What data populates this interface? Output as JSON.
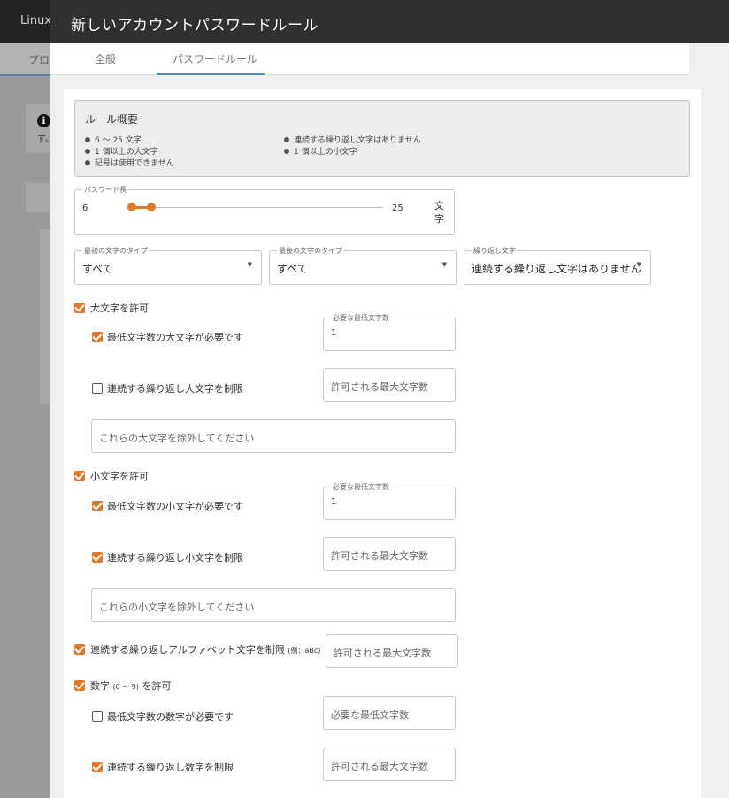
{
  "background": {
    "app_title": "Linux",
    "tab_partial": "プロ",
    "info_text": "す。"
  },
  "dialog": {
    "title": "新しいアカウントパスワードルール",
    "tabs": [
      {
        "label": "全般",
        "active": false
      },
      {
        "label": "パスワードルール",
        "active": true
      }
    ],
    "accent_color": "#e37828"
  },
  "summary": {
    "title": "ルール概要",
    "items_left": [
      "6 ～ 25 文字",
      "1 個以上の大文字",
      "記号は使用できません"
    ],
    "items_right": [
      "連続する繰り返し文字はありません",
      "1 個以上の小文字"
    ]
  },
  "length": {
    "legend": "パスワード長",
    "min": "6",
    "max": "25",
    "unit": "文字",
    "range_min": 6,
    "range_max": 25
  },
  "selects": [
    {
      "legend": "最初の文字のタイプ",
      "value": "すべて"
    },
    {
      "legend": "最後の文字のタイプ",
      "value": "すべて"
    },
    {
      "legend": "繰り返し文字",
      "value": "連続する繰り返し文字はありません"
    }
  ],
  "uppercase": {
    "allow_label": "大文字を許可",
    "allow": true,
    "min_label": "最低文字数の大文字が必要です",
    "min_checked": true,
    "min_legend": "必要な最低文字数",
    "min_value": "1",
    "repeat_label": "連続する繰り返し大文字を制限",
    "repeat_checked": false,
    "repeat_placeholder": "許可される最大文字数",
    "exclude_placeholder": "これらの大文字を除外してください"
  },
  "lowercase": {
    "allow_label": "小文字を許可",
    "allow": true,
    "min_label": "最低文字数の小文字が必要です",
    "min_checked": true,
    "min_legend": "必要な最低文字数",
    "min_value": "1",
    "repeat_label": "連続する繰り返し小文字を制限",
    "repeat_checked": true,
    "repeat_placeholder": "許可される最大文字数",
    "exclude_placeholder": "これらの小文字を除外してください"
  },
  "alpha_repeat": {
    "label": "連続する繰り返しアルファベット文字を制限",
    "example": "(例：aBc)",
    "checked": true,
    "placeholder": "許可される最大文字数"
  },
  "digits": {
    "allow_label": "数字",
    "range": "(0 ～ 9)",
    "allow_suffix": "を許可",
    "allow": true,
    "min_label": "最低文字数の数字が必要です",
    "min_checked": false,
    "min_placeholder": "必要な最低文字数",
    "repeat_label": "連続する繰り返し数字を制限",
    "repeat_checked": true,
    "repeat_placeholder": "許可される最大文字数"
  }
}
